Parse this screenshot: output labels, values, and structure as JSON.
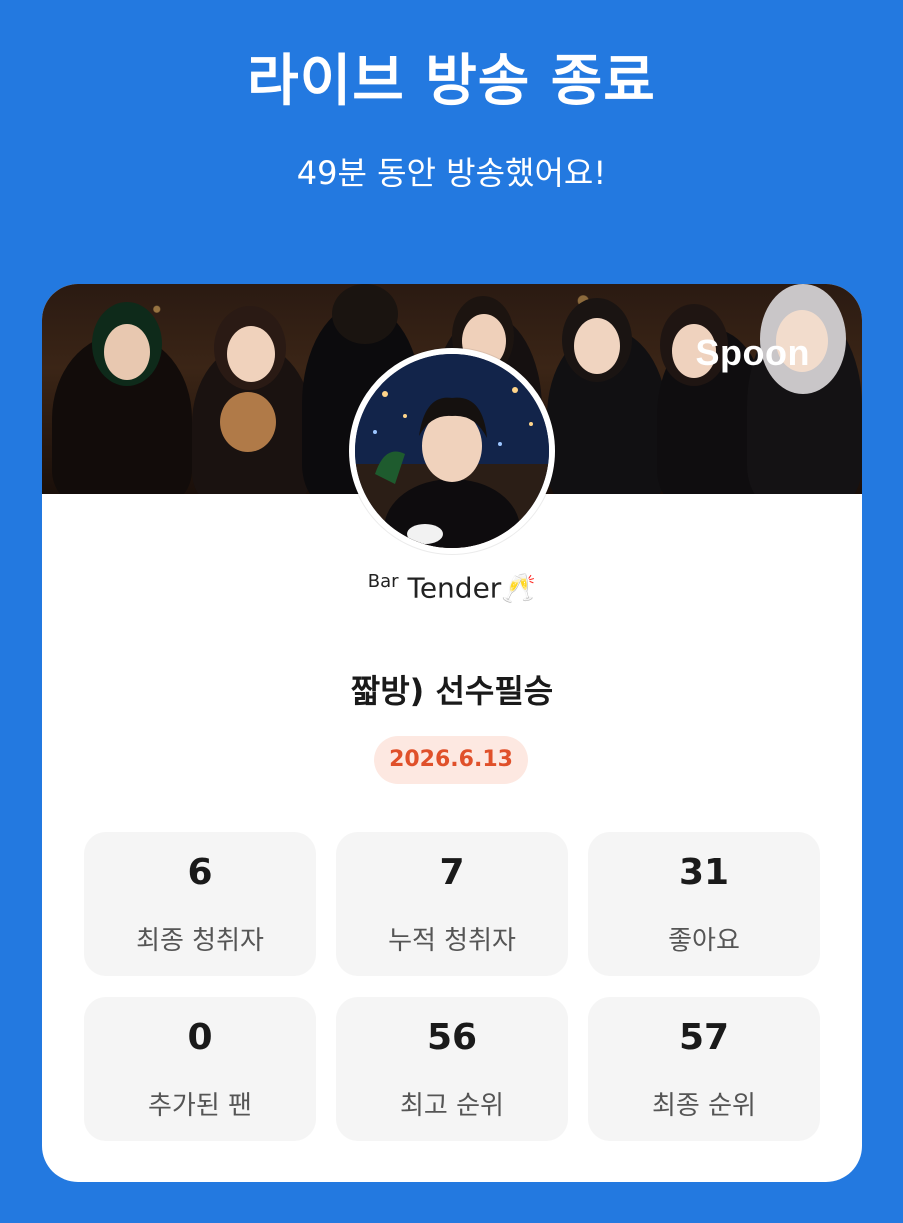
{
  "header": {
    "title": "라이브 방송 종료",
    "subtitle": "49분 동안 방송했어요!"
  },
  "card": {
    "brand_logo": "Spoon",
    "host": {
      "name_prefix": "Bar",
      "name": "Tender",
      "emoji": "🥂"
    },
    "room_title": "짧방) 선수필승",
    "date": "2026.6.13",
    "stats": [
      {
        "value": "6",
        "label": "최종 청취자"
      },
      {
        "value": "7",
        "label": "누적 청취자"
      },
      {
        "value": "31",
        "label": "좋아요"
      },
      {
        "value": "0",
        "label": "추가된 팬"
      },
      {
        "value": "56",
        "label": "최고 순위"
      },
      {
        "value": "57",
        "label": "최종 순위"
      }
    ]
  },
  "colors": {
    "background": "#2379e0",
    "date_badge_bg": "#fde8e1",
    "date_badge_text": "#e0502a",
    "stat_tile_bg": "#f5f5f5"
  }
}
